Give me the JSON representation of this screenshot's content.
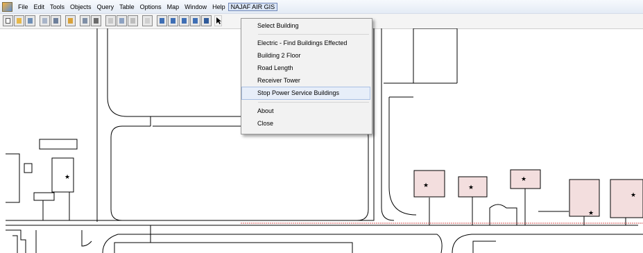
{
  "menubar": {
    "items": [
      "File",
      "Edit",
      "Tools",
      "Objects",
      "Query",
      "Table",
      "Options",
      "Map",
      "Window",
      "Help",
      "NAJAF AIR GIS"
    ]
  },
  "dropdown": {
    "items": [
      "Select Building",
      "Electric - Find Buildings Effected",
      "Building 2 Floor",
      "Road Length",
      "Receiver Tower",
      "Stop Power Service Buildings",
      "About",
      "Close"
    ],
    "hovered_item": "Stop Power Service Buildings"
  },
  "map": {
    "building_marker": "★",
    "building_fill": "#f3dede",
    "line_color": "#000000",
    "power_line_color": "#d04a4a"
  }
}
